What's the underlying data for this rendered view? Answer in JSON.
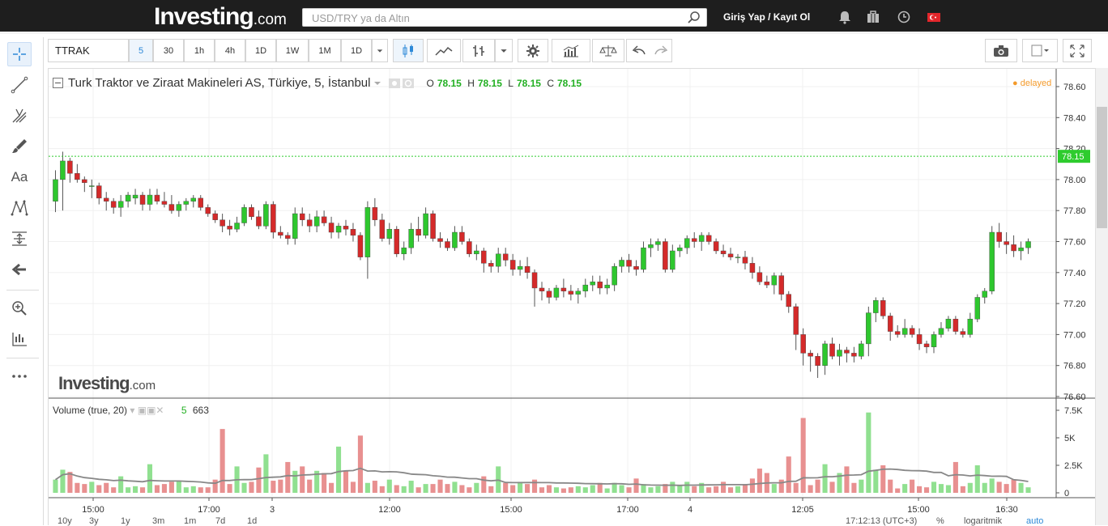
{
  "header": {
    "logo_main": "Investing",
    "logo_suffix": ".com",
    "search_placeholder": "USD/TRY ya da Altın",
    "login_label": "Giriş Yap / Kayıt Ol",
    "icons": [
      "bell-icon",
      "briefcase-icon",
      "clock-icon",
      "turkey-flag-icon"
    ]
  },
  "left_tools": [
    "crosshair-icon",
    "trend-line-icon",
    "pitchfork-icon",
    "brush-icon",
    "text-tool-icon",
    "pattern-icon",
    "measure-icon",
    "arrow-left-icon",
    "zoom-in-icon",
    "bar-scale-icon",
    "more-icon"
  ],
  "left_text_tool_label": "Aa",
  "toolbar": {
    "symbol": "TTRAK",
    "intervals": [
      "5",
      "30",
      "1h",
      "4h",
      "1D",
      "1W",
      "1M",
      "1D"
    ],
    "selected_interval": "5"
  },
  "chart": {
    "title": "Turk Traktor ve Ziraat Makineleri AS, Türkiye, 5, İstanbul",
    "ohlc": {
      "O": "78.15",
      "H": "78.15",
      "L": "78.15",
      "C": "78.15"
    },
    "status": "delayed",
    "last_price": "78.15",
    "watermark_main": "Investing",
    "watermark_suffix": ".com",
    "colors": {
      "up": "#2ec72e",
      "down": "#d42a2a",
      "up_vol": "#90e090",
      "down_vol": "#e89090",
      "last_line": "#2ecc2e"
    }
  },
  "volume": {
    "label": "Volume (true, 20)",
    "interval": "5",
    "value": "663"
  },
  "bottom": {
    "ranges": [
      "10y",
      "3y",
      "1y",
      "3m",
      "1m",
      "7d",
      "1d"
    ],
    "time": "17:12:13 (UTC+3)",
    "percent_label": "%",
    "log_label": "logaritmik",
    "auto_label": "auto"
  },
  "chart_data": {
    "type": "candlestick",
    "price_axis": [
      "78.60",
      "78.40",
      "78.20",
      "78.00",
      "77.80",
      "77.60",
      "77.40",
      "77.20",
      "77.00",
      "76.80",
      "76.60"
    ],
    "ylim": [
      76.6,
      78.6
    ],
    "volume_axis": [
      "7.5K",
      "5K",
      "2.5K",
      "0"
    ],
    "volume_ylim": [
      0,
      7500
    ],
    "time_axis": [
      "15:00",
      "17:00",
      "3",
      "12:00",
      "15:00",
      "17:00",
      "4",
      "12:05",
      "15:00",
      "16:30"
    ],
    "candles": [
      [
        77.86,
        78.06,
        77.79,
        78.0,
        1200
      ],
      [
        78.0,
        78.18,
        77.8,
        78.12,
        2100
      ],
      [
        78.12,
        78.14,
        77.98,
        78.04,
        1900
      ],
      [
        78.04,
        78.1,
        77.98,
        78.0,
        900
      ],
      [
        78.0,
        78.02,
        77.92,
        77.98,
        800
      ],
      [
        77.96,
        78.0,
        77.88,
        77.96,
        1000
      ],
      [
        77.96,
        77.98,
        77.84,
        77.88,
        700
      ],
      [
        77.88,
        77.92,
        77.8,
        77.86,
        900
      ],
      [
        77.86,
        77.88,
        77.78,
        77.82,
        500
      ],
      [
        77.82,
        77.9,
        77.76,
        77.86,
        1500
      ],
      [
        77.86,
        77.92,
        77.82,
        77.9,
        500
      ],
      [
        77.88,
        77.94,
        77.84,
        77.9,
        600
      ],
      [
        77.9,
        77.92,
        77.8,
        77.84,
        500
      ],
      [
        77.84,
        77.94,
        77.8,
        77.9,
        2600
      ],
      [
        77.9,
        77.94,
        77.84,
        77.86,
        700
      ],
      [
        77.86,
        77.92,
        77.82,
        77.84,
        800
      ],
      [
        77.84,
        77.9,
        77.78,
        77.8,
        1000
      ],
      [
        77.8,
        77.86,
        77.76,
        77.84,
        1100
      ],
      [
        77.84,
        77.88,
        77.8,
        77.86,
        500
      ],
      [
        77.86,
        77.9,
        77.82,
        77.88,
        600
      ],
      [
        77.88,
        77.9,
        77.8,
        77.82,
        500
      ],
      [
        77.82,
        77.84,
        77.76,
        77.78,
        500
      ],
      [
        77.78,
        77.8,
        77.72,
        77.74,
        1200
      ],
      [
        77.74,
        77.78,
        77.66,
        77.7,
        5800
      ],
      [
        77.7,
        77.74,
        77.64,
        77.68,
        800
      ],
      [
        77.68,
        77.76,
        77.66,
        77.72,
        2400
      ],
      [
        77.72,
        77.84,
        77.7,
        77.82,
        900
      ],
      [
        77.82,
        77.84,
        77.74,
        77.76,
        1000
      ],
      [
        77.76,
        77.8,
        77.68,
        77.7,
        2300
      ],
      [
        77.7,
        77.86,
        77.68,
        77.84,
        3500
      ],
      [
        77.84,
        77.86,
        77.62,
        77.66,
        1100
      ],
      [
        77.66,
        77.7,
        77.62,
        77.64,
        1200
      ],
      [
        77.64,
        77.66,
        77.58,
        77.62,
        2800
      ],
      [
        77.62,
        77.82,
        77.58,
        77.78,
        2000
      ],
      [
        77.78,
        77.82,
        77.7,
        77.74,
        2400
      ],
      [
        77.74,
        77.78,
        77.66,
        77.7,
        1200
      ],
      [
        77.7,
        77.8,
        77.66,
        77.76,
        2000
      ],
      [
        77.76,
        77.8,
        77.7,
        77.72,
        1800
      ],
      [
        77.72,
        77.76,
        77.62,
        77.66,
        900
      ],
      [
        77.66,
        77.72,
        77.62,
        77.7,
        4200
      ],
      [
        77.7,
        77.74,
        77.64,
        77.68,
        2000
      ],
      [
        77.68,
        77.72,
        77.6,
        77.64,
        1000
      ],
      [
        77.64,
        77.66,
        77.48,
        77.5,
        5200
      ],
      [
        77.5,
        77.86,
        77.36,
        77.82,
        900
      ],
      [
        77.82,
        77.88,
        77.7,
        77.74,
        1100
      ],
      [
        77.74,
        77.78,
        77.6,
        77.62,
        600
      ],
      [
        77.62,
        77.72,
        77.58,
        77.68,
        1200
      ],
      [
        77.68,
        77.7,
        77.5,
        77.52,
        700
      ],
      [
        77.52,
        77.6,
        77.48,
        77.56,
        600
      ],
      [
        77.56,
        77.72,
        77.52,
        77.68,
        1100
      ],
      [
        77.68,
        77.76,
        77.6,
        77.64,
        500
      ],
      [
        77.64,
        77.82,
        77.62,
        77.78,
        800
      ],
      [
        77.78,
        77.8,
        77.6,
        77.62,
        800
      ],
      [
        77.62,
        77.66,
        77.56,
        77.6,
        1200
      ],
      [
        77.6,
        77.62,
        77.54,
        77.56,
        800
      ],
      [
        77.56,
        77.7,
        77.54,
        77.66,
        1000
      ],
      [
        77.66,
        77.7,
        77.58,
        77.6,
        700
      ],
      [
        77.6,
        77.62,
        77.5,
        77.52,
        500
      ],
      [
        77.52,
        77.58,
        77.48,
        77.54,
        900
      ],
      [
        77.54,
        77.56,
        77.4,
        77.46,
        1500
      ],
      [
        77.46,
        77.48,
        77.4,
        77.44,
        600
      ],
      [
        77.44,
        77.56,
        77.4,
        77.52,
        2400
      ],
      [
        77.52,
        77.56,
        77.44,
        77.48,
        900
      ],
      [
        77.48,
        77.52,
        77.38,
        77.42,
        700
      ],
      [
        77.42,
        77.48,
        77.38,
        77.44,
        1000
      ],
      [
        77.44,
        77.5,
        77.36,
        77.4,
        800
      ],
      [
        77.4,
        77.42,
        77.18,
        77.3,
        1200
      ],
      [
        77.3,
        77.34,
        77.22,
        77.28,
        500
      ],
      [
        77.28,
        77.3,
        77.2,
        77.24,
        700
      ],
      [
        77.24,
        77.32,
        77.22,
        77.3,
        500
      ],
      [
        77.3,
        77.36,
        77.24,
        77.28,
        400
      ],
      [
        77.28,
        77.32,
        77.22,
        77.26,
        500
      ],
      [
        77.26,
        77.3,
        77.2,
        77.28,
        600
      ],
      [
        77.28,
        77.36,
        77.24,
        77.32,
        500
      ],
      [
        77.32,
        77.38,
        77.28,
        77.34,
        700
      ],
      [
        77.34,
        77.38,
        77.26,
        77.3,
        900
      ],
      [
        77.3,
        77.36,
        77.26,
        77.32,
        400
      ],
      [
        77.32,
        77.46,
        77.28,
        77.44,
        900
      ],
      [
        77.44,
        77.5,
        77.4,
        77.48,
        700
      ],
      [
        77.48,
        77.52,
        77.4,
        77.44,
        500
      ],
      [
        77.44,
        77.48,
        77.38,
        77.42,
        1300
      ],
      [
        77.42,
        77.6,
        77.4,
        77.56,
        800
      ],
      [
        77.56,
        77.62,
        77.5,
        77.58,
        500
      ],
      [
        77.58,
        77.62,
        77.54,
        77.6,
        600
      ],
      [
        77.6,
        77.62,
        77.4,
        77.42,
        800
      ],
      [
        77.42,
        77.58,
        77.4,
        77.54,
        1000
      ],
      [
        77.54,
        77.58,
        77.5,
        77.56,
        700
      ],
      [
        77.56,
        77.64,
        77.52,
        77.62,
        1000
      ],
      [
        77.62,
        77.66,
        77.56,
        77.6,
        600
      ],
      [
        77.6,
        77.66,
        77.54,
        77.64,
        900
      ],
      [
        77.64,
        77.66,
        77.58,
        77.6,
        500
      ],
      [
        77.6,
        77.62,
        77.52,
        77.54,
        600
      ],
      [
        77.54,
        77.58,
        77.5,
        77.52,
        1000
      ],
      [
        77.52,
        77.56,
        77.48,
        77.5,
        500
      ],
      [
        77.5,
        77.52,
        77.46,
        77.5,
        600
      ],
      [
        77.5,
        77.54,
        77.42,
        77.46,
        800
      ],
      [
        77.46,
        77.5,
        77.36,
        77.4,
        1300
      ],
      [
        77.4,
        77.44,
        77.32,
        77.34,
        2200
      ],
      [
        77.34,
        77.38,
        77.3,
        77.32,
        1800
      ],
      [
        77.32,
        77.4,
        77.26,
        77.38,
        800
      ],
      [
        77.38,
        77.4,
        77.22,
        77.26,
        1200
      ],
      [
        77.26,
        77.28,
        77.14,
        77.18,
        3300
      ],
      [
        77.18,
        77.2,
        76.9,
        77.0,
        900
      ],
      [
        77.0,
        77.04,
        76.8,
        76.88,
        6800
      ],
      [
        76.88,
        76.9,
        76.76,
        76.86,
        700
      ],
      [
        76.86,
        76.88,
        76.72,
        76.8,
        1200
      ],
      [
        76.8,
        76.96,
        76.74,
        76.94,
        2600
      ],
      [
        76.94,
        76.98,
        76.84,
        76.86,
        1000
      ],
      [
        76.86,
        76.94,
        76.8,
        76.9,
        1800
      ],
      [
        76.9,
        76.92,
        76.82,
        76.88,
        2400
      ],
      [
        76.88,
        76.92,
        76.82,
        76.86,
        900
      ],
      [
        76.86,
        76.96,
        76.84,
        76.94,
        1200
      ],
      [
        76.94,
        77.18,
        76.86,
        77.14,
        7300
      ],
      [
        77.14,
        77.24,
        77.08,
        77.22,
        2100
      ],
      [
        77.22,
        77.24,
        77.1,
        77.12,
        2500
      ],
      [
        77.12,
        77.14,
        76.96,
        77.02,
        1200
      ],
      [
        77.02,
        77.06,
        76.98,
        77.0,
        400
      ],
      [
        77.0,
        77.1,
        76.98,
        77.04,
        800
      ],
      [
        77.04,
        77.06,
        76.98,
        77.0,
        1200
      ],
      [
        77.0,
        77.04,
        76.9,
        76.94,
        600
      ],
      [
        76.94,
        76.96,
        76.88,
        76.92,
        500
      ],
      [
        76.92,
        77.02,
        76.88,
        77.0,
        1000
      ],
      [
        77.0,
        77.08,
        76.98,
        77.04,
        800
      ],
      [
        77.04,
        77.12,
        77.02,
        77.1,
        700
      ],
      [
        77.1,
        77.12,
        77.0,
        77.02,
        2800
      ],
      [
        77.02,
        77.04,
        76.98,
        77.0,
        600
      ],
      [
        77.0,
        77.14,
        76.98,
        77.1,
        900
      ],
      [
        77.1,
        77.26,
        77.08,
        77.24,
        2500
      ],
      [
        77.24,
        77.3,
        77.2,
        77.28,
        900
      ],
      [
        77.28,
        77.7,
        77.26,
        77.66,
        1300
      ],
      [
        77.66,
        77.72,
        77.56,
        77.6,
        1000
      ],
      [
        77.6,
        77.66,
        77.52,
        77.58,
        800
      ],
      [
        77.58,
        77.64,
        77.5,
        77.54,
        1200
      ],
      [
        77.54,
        77.6,
        77.48,
        77.56,
        900
      ],
      [
        77.56,
        77.62,
        77.52,
        77.6,
        500
      ]
    ]
  }
}
